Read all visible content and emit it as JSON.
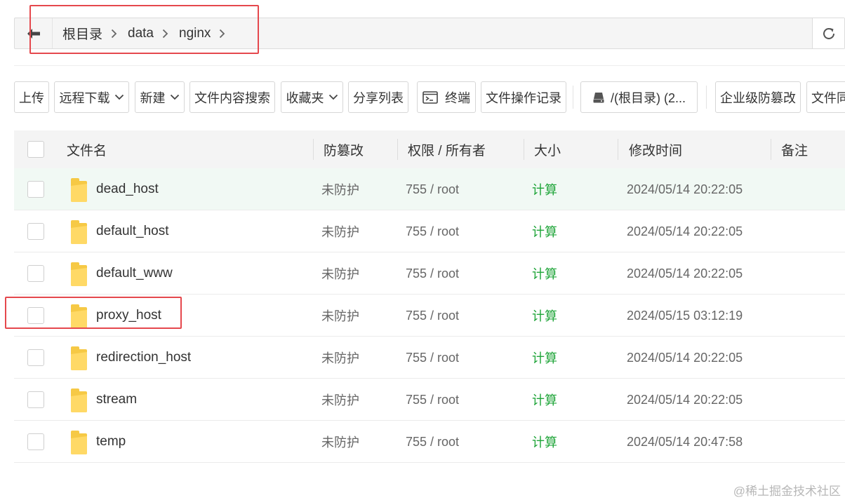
{
  "breadcrumb": {
    "items": [
      "根目录",
      "data",
      "nginx"
    ]
  },
  "toolbar": {
    "upload": "上传",
    "remote_download": "远程下载",
    "new": "新建",
    "content_search": "文件内容搜索",
    "favorites": "收藏夹",
    "share_list": "分享列表",
    "terminal": "终端",
    "file_log": "文件操作记录",
    "disk": "/(根目录) (2...",
    "tamper_proof": "企业级防篡改",
    "file_sync": "文件同"
  },
  "table": {
    "headers": {
      "name": "文件名",
      "tamper": "防篡改",
      "perm": "权限 / 所有者",
      "size": "大小",
      "mtime": "修改时间",
      "note": "备注"
    },
    "rows": [
      {
        "name": "dead_host",
        "tamper": "未防护",
        "perm": "755 / root",
        "size": "计算",
        "mtime": "2024/05/14 20:22:05"
      },
      {
        "name": "default_host",
        "tamper": "未防护",
        "perm": "755 / root",
        "size": "计算",
        "mtime": "2024/05/14 20:22:05"
      },
      {
        "name": "default_www",
        "tamper": "未防护",
        "perm": "755 / root",
        "size": "计算",
        "mtime": "2024/05/14 20:22:05"
      },
      {
        "name": "proxy_host",
        "tamper": "未防护",
        "perm": "755 / root",
        "size": "计算",
        "mtime": "2024/05/15 03:12:19"
      },
      {
        "name": "redirection_host",
        "tamper": "未防护",
        "perm": "755 / root",
        "size": "计算",
        "mtime": "2024/05/14 20:22:05"
      },
      {
        "name": "stream",
        "tamper": "未防护",
        "perm": "755 / root",
        "size": "计算",
        "mtime": "2024/05/14 20:22:05"
      },
      {
        "name": "temp",
        "tamper": "未防护",
        "perm": "755 / root",
        "size": "计算",
        "mtime": "2024/05/14 20:47:58"
      }
    ]
  },
  "watermark": "@稀土掘金技术社区",
  "colors": {
    "accent_green": "#20a53a",
    "highlight_red": "#e5484d",
    "folder_yellow": "#f6c945"
  },
  "icons": [
    "back-arrow-icon",
    "chevron-right-icon",
    "refresh-icon",
    "chevron-down-icon",
    "terminal-icon",
    "disk-icon",
    "folder-icon"
  ]
}
